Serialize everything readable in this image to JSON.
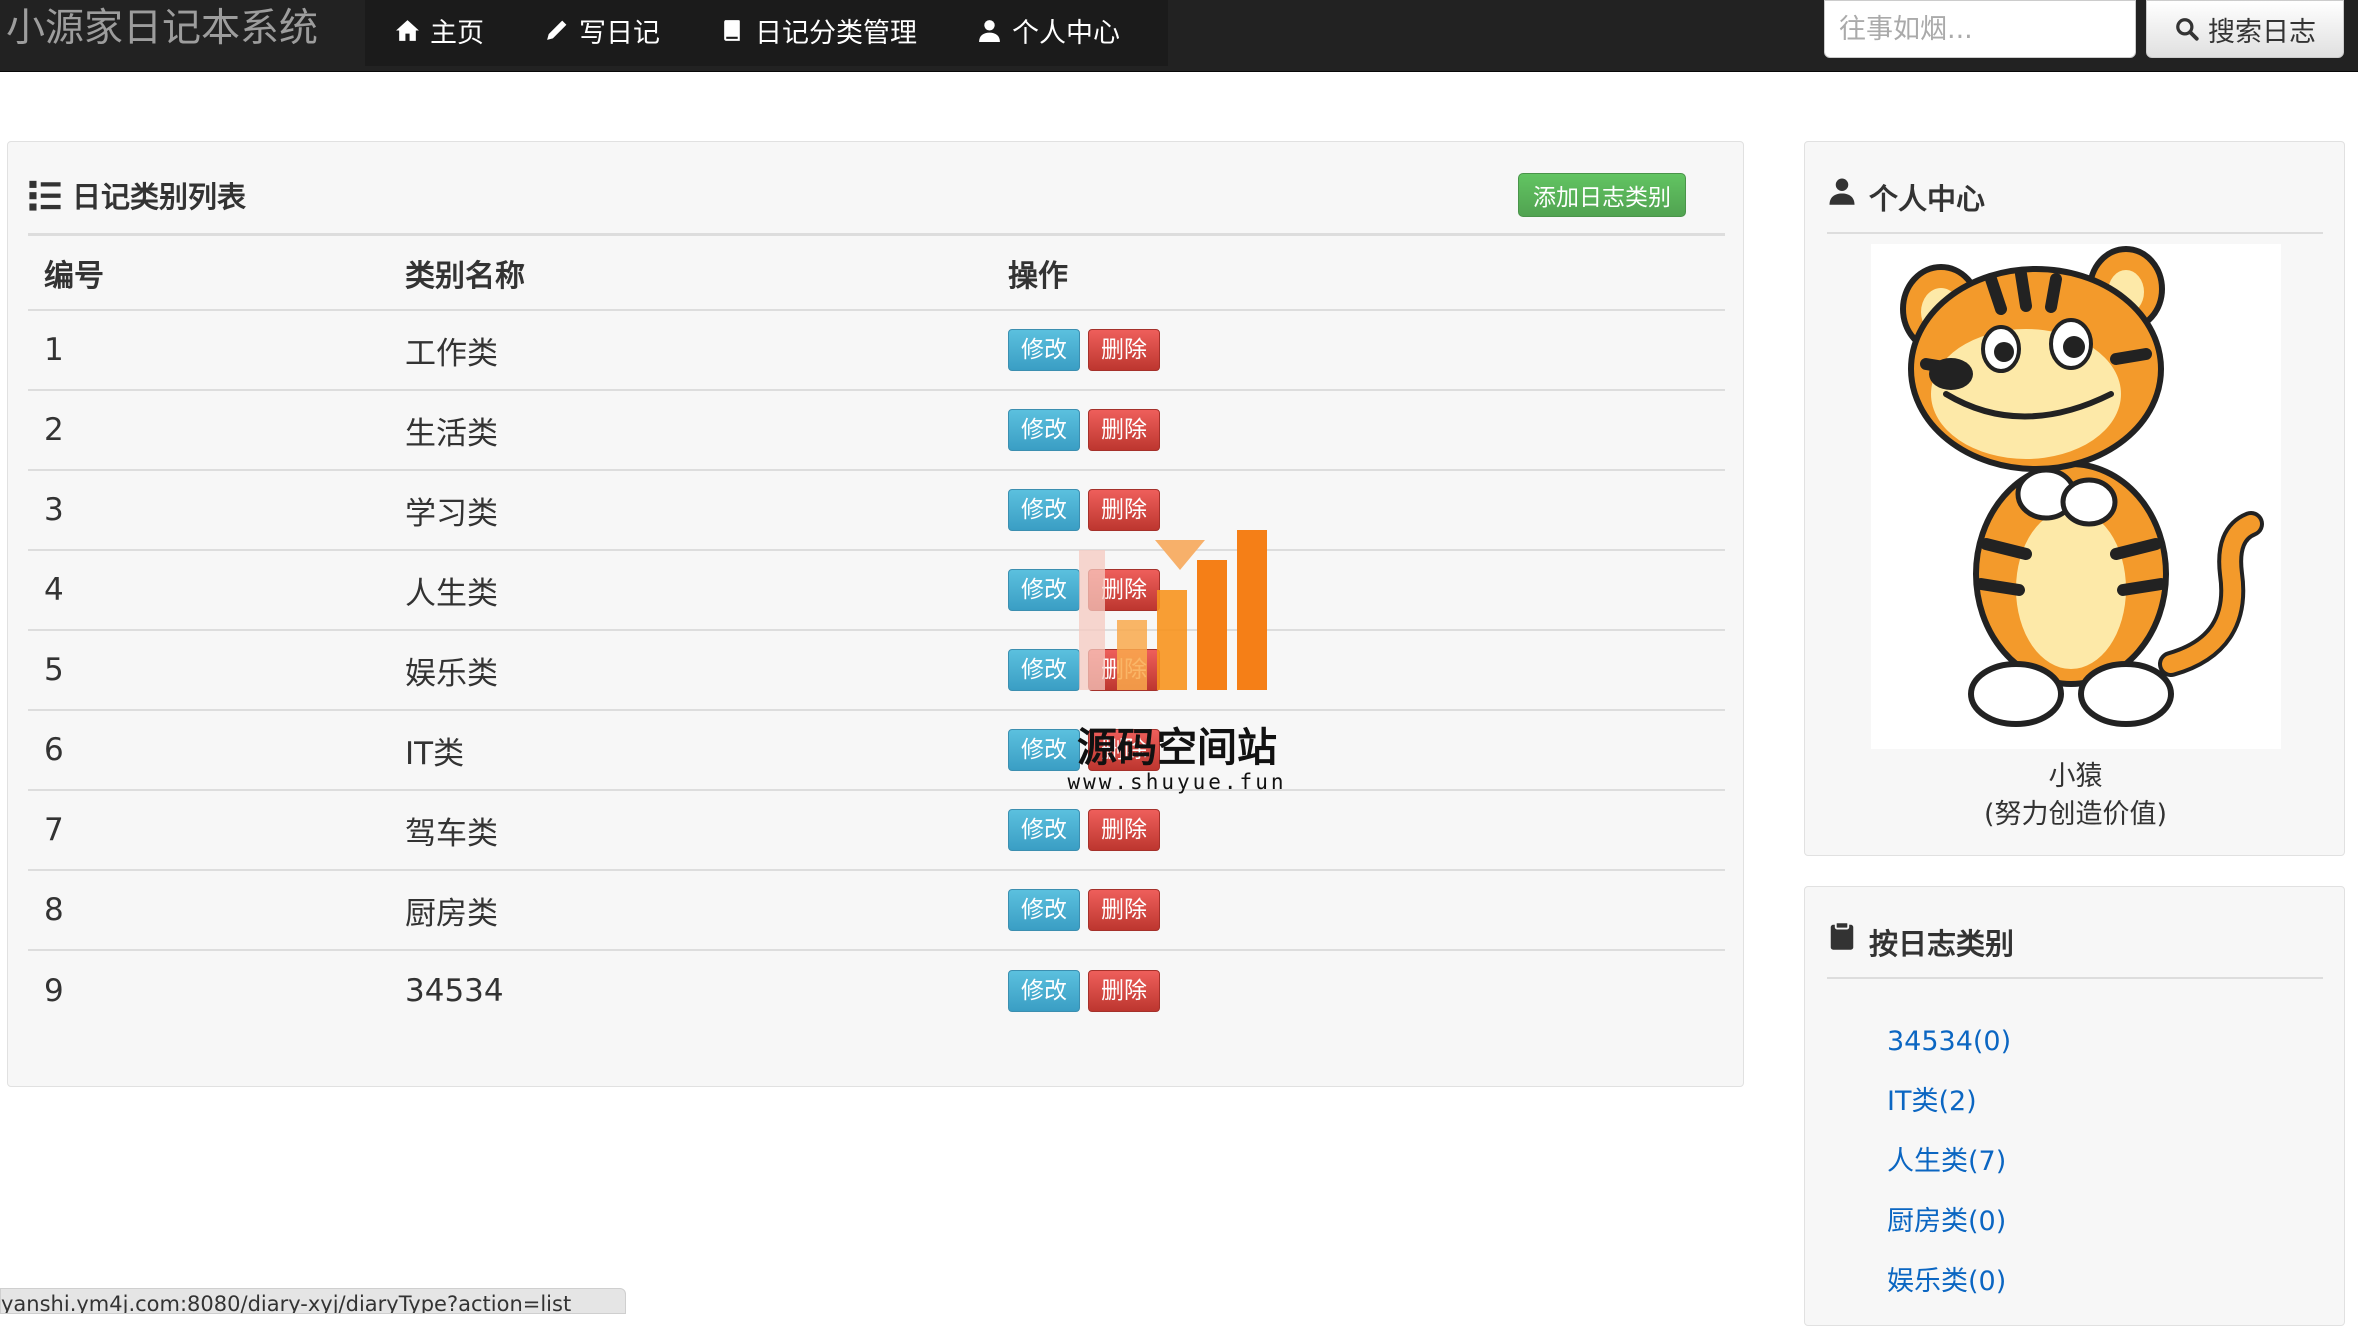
{
  "navbar": {
    "brand": "小源家日记本系统",
    "items": [
      {
        "label": "主页",
        "icon": "home-icon"
      },
      {
        "label": "写日记",
        "icon": "pencil-icon"
      },
      {
        "label": "日记分类管理",
        "icon": "book-icon"
      },
      {
        "label": "个人中心",
        "icon": "user-icon"
      }
    ],
    "search_placeholder": "往事如烟...",
    "search_label": "搜索日志"
  },
  "main": {
    "title": "日记类别列表",
    "add_label": "添加日志类别",
    "columns": [
      "编号",
      "类别名称",
      "操作"
    ],
    "edit_label": "修改",
    "delete_label": "删除",
    "rows": [
      {
        "id": "1",
        "name": "工作类"
      },
      {
        "id": "2",
        "name": "生活类"
      },
      {
        "id": "3",
        "name": "学习类"
      },
      {
        "id": "4",
        "name": "人生类"
      },
      {
        "id": "5",
        "name": "娱乐类"
      },
      {
        "id": "6",
        "name": "IT类"
      },
      {
        "id": "7",
        "name": "驾车类"
      },
      {
        "id": "8",
        "name": "厨房类"
      },
      {
        "id": "9",
        "name": "34534"
      }
    ]
  },
  "profile": {
    "title": "个人中心",
    "name": "小猿",
    "motto": "(努力创造价值)"
  },
  "types": {
    "title": "按日志类别",
    "items": [
      "34534(0)",
      "IT类(2)",
      "人生类(7)",
      "厨房类(0)",
      "娱乐类(0)"
    ]
  },
  "watermark": {
    "title": "源码空间站",
    "url": "www.shuyue.fun"
  },
  "status_url": "yanshi.ym4j.com:8080/diary-xyj/diaryType?action=list",
  "colors": {
    "navbar": "#222222",
    "link": "#0b66c2",
    "success": "#51a351",
    "info": "#3a9ec4",
    "danger": "#bd362f"
  }
}
